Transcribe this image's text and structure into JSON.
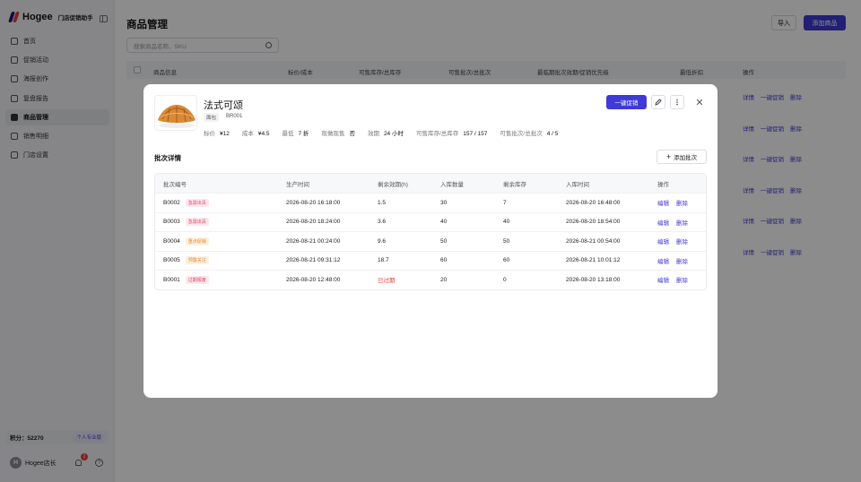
{
  "sidebar": {
    "brand_name": "Hogee",
    "brand_sub": "门店促销助手",
    "items": [
      {
        "label": "首页",
        "icon": "home-icon"
      },
      {
        "label": "促销活动",
        "icon": "tag-icon"
      },
      {
        "label": "海报创作",
        "icon": "image-icon"
      },
      {
        "label": "复盘报告",
        "icon": "report-icon"
      },
      {
        "label": "商品管理",
        "icon": "bag-icon",
        "active": true
      },
      {
        "label": "销售明细",
        "icon": "list-icon"
      },
      {
        "label": "门店设置",
        "icon": "store-icon"
      }
    ],
    "points_label": "积分：",
    "points_value": "52270",
    "plan_badge": "个人专业版",
    "user_initial": "H",
    "user_name": "Hogee店长",
    "notif_count": "2"
  },
  "main": {
    "title": "商品管理",
    "import_label": "导入",
    "add_label": "添加商品",
    "search_placeholder": "搜索商品名称、SKU",
    "columns": [
      "商品信息",
      "标价/成本",
      "可售库存/总库存",
      "可售批次/总批次",
      "最临期批次效期/促销优先级",
      "最低折扣",
      "操作"
    ],
    "row_actions": [
      "详情",
      "一键促销",
      "删除"
    ]
  },
  "modal": {
    "product_name": "法式可颂",
    "category": "面包",
    "sku": "BR001",
    "stats": [
      {
        "k": "标价",
        "v": "¥12"
      },
      {
        "k": "成本",
        "v": "¥4.5"
      },
      {
        "k": "最低",
        "v": "7 折"
      },
      {
        "k": "现做现售",
        "v": "否"
      },
      {
        "k": "效期",
        "v": "24 小时"
      },
      {
        "k": "可售库存/总库存",
        "v": "157 / 157"
      },
      {
        "k": "可售批次/总批次",
        "v": "4 / 5"
      }
    ],
    "promo_button": "一键促销",
    "section_title": "批次详情",
    "add_batch_label": "添加批次",
    "columns": [
      "批次编号",
      "生产时间",
      "剩余效期(h)",
      "入库数量",
      "剩余库存",
      "入库时间",
      "操作"
    ],
    "rows": [
      {
        "id": "B0002",
        "tag": "急需出清",
        "tag_color": "red",
        "produced": "2026-08-20 16:18:00",
        "remaining": "1.5",
        "qty_in": "30",
        "stock": "7",
        "stocked_at": "2026-08-20 16:48:00"
      },
      {
        "id": "B0003",
        "tag": "急需出清",
        "tag_color": "red",
        "produced": "2026-08-20 18:24:00",
        "remaining": "3.6",
        "qty_in": "40",
        "stock": "40",
        "stocked_at": "2026-08-20 18:54:00"
      },
      {
        "id": "B0004",
        "tag": "重点促销",
        "tag_color": "orange",
        "produced": "2026-08-21 00:24:00",
        "remaining": "9.6",
        "qty_in": "50",
        "stock": "50",
        "stocked_at": "2026-08-21 00:54:00"
      },
      {
        "id": "B0005",
        "tag": "预警关注",
        "tag_color": "orange",
        "produced": "2026-08-21 09:31:12",
        "remaining": "18.7",
        "qty_in": "60",
        "stock": "60",
        "stocked_at": "2026-08-21 10:01:12"
      },
      {
        "id": "B0001",
        "tag": "过期报废",
        "tag_color": "red",
        "produced": "2026-08-20 12:48:00",
        "remaining": "已过期",
        "qty_in": "20",
        "stock": "0",
        "stocked_at": "2026-08-20 13:18:00"
      }
    ],
    "row_actions": [
      "编辑",
      "删除"
    ]
  },
  "colors": {
    "accent": "#3f3ad6",
    "danger": "#e8413b"
  }
}
